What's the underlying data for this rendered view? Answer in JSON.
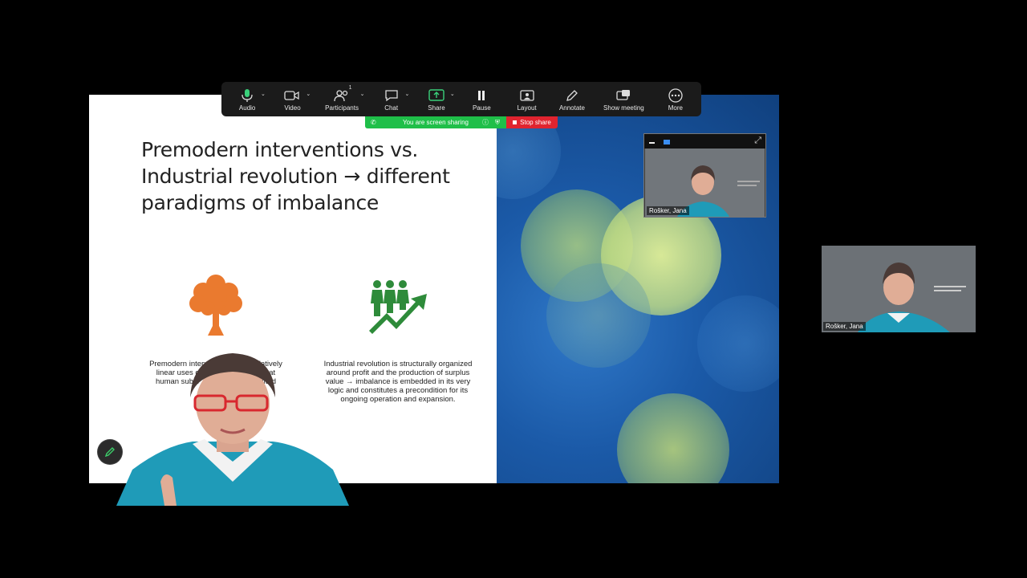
{
  "slide": {
    "title": "Premodern interventions vs. Industrial revolution → different paradigms of imbalance",
    "left_col_text_line1": "Premodern interv",
    "left_col_text_line1b": "nd relatively",
    "left_col_text_line2": "linear uses o",
    "left_col_text_line2b": "imed at",
    "left_col_text_line3": "human subsi",
    "left_col_text_line3b": "delimited",
    "right_col_text": "Industrial revolution is structurally organized around profit and the production of surplus value → imbalance is embedded in its very logic and constitutes a precondition for its ongoing operation and expansion."
  },
  "toolbar": {
    "items": [
      {
        "label": "Audio",
        "icon": "microphone-icon"
      },
      {
        "label": "Video",
        "icon": "camera-icon"
      },
      {
        "label": "Participants",
        "icon": "participants-icon",
        "badge": "1"
      },
      {
        "label": "Chat",
        "icon": "chat-icon"
      },
      {
        "label": "Share",
        "icon": "share-screen-icon"
      },
      {
        "label": "Pause",
        "icon": "pause-icon"
      },
      {
        "label": "Layout",
        "icon": "layout-icon"
      },
      {
        "label": "Annotate",
        "icon": "pen-icon"
      },
      {
        "label": "Show meeting",
        "icon": "show-meeting-icon"
      },
      {
        "label": "More",
        "icon": "more-icon"
      }
    ]
  },
  "share_banner": {
    "text": "You are screen sharing",
    "stop_label": "Stop share"
  },
  "floating_video": {
    "name": "Rošker, Jana"
  },
  "side_video": {
    "name": "Rošker, Jana"
  },
  "colors": {
    "accent_green": "#1fbf49",
    "stop_red": "#e0242f",
    "tree_orange": "#ea7a2f",
    "growth_green": "#2e8b3a"
  }
}
